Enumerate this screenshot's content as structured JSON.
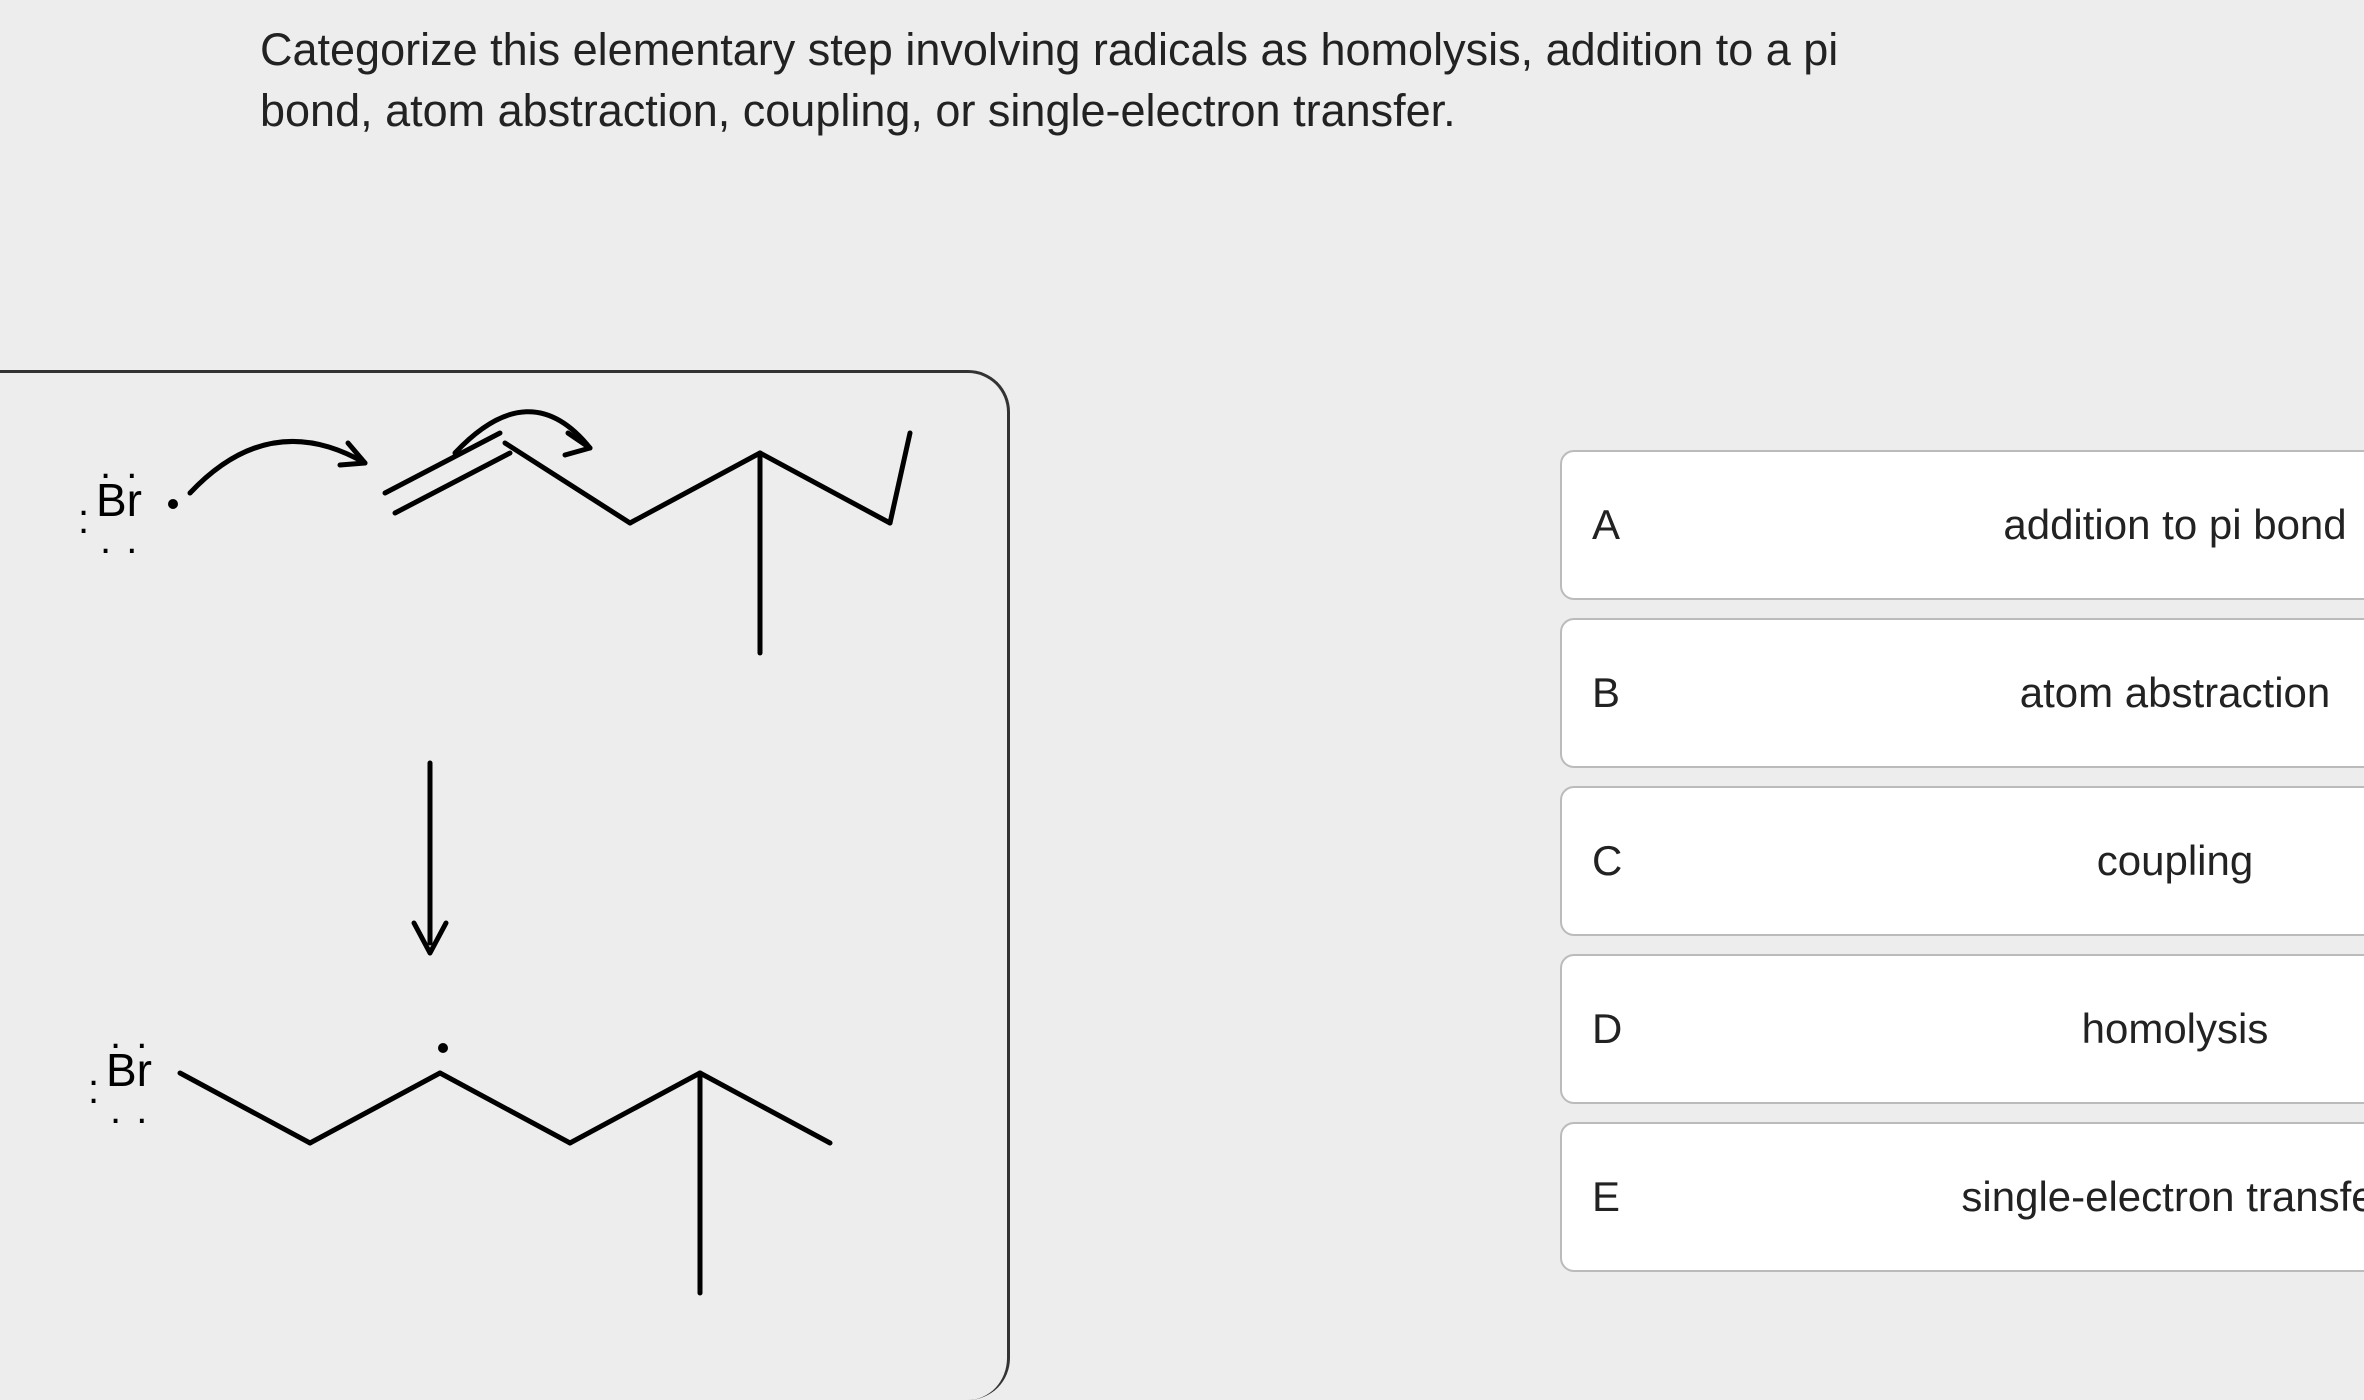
{
  "question": {
    "text": "Categorize this elementary step involving radicals as homolysis, addition to a pi bond, atom abstraction, coupling, or single-electron transfer."
  },
  "reactant": {
    "br_label": "Br",
    "has_radical_dot": true
  },
  "product": {
    "br_label": "Br",
    "has_radical_dot": true
  },
  "options": [
    {
      "letter": "A",
      "label": "addition to pi bond"
    },
    {
      "letter": "B",
      "label": "atom abstraction"
    },
    {
      "letter": "C",
      "label": "coupling"
    },
    {
      "letter": "D",
      "label": "homolysis"
    },
    {
      "letter": "E",
      "label": "single-electron transfer"
    }
  ]
}
